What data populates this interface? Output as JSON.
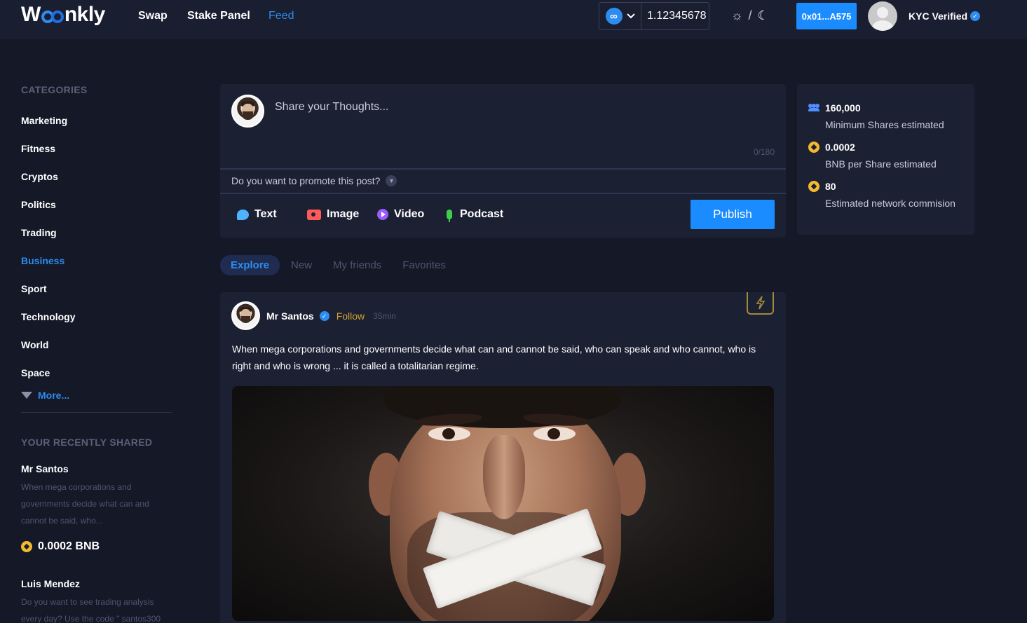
{
  "header": {
    "logo_text": "Woonkly",
    "nav": [
      {
        "label": "Swap"
      },
      {
        "label": "Stake Panel"
      },
      {
        "label": "Feed"
      }
    ],
    "token_value": "1.12345678",
    "theme_separator": "/",
    "wallet_label": "0x01...A575",
    "kyc_label": "KYC Verified"
  },
  "sidebar": {
    "categories_heading": "CATEGORIES",
    "categories": [
      {
        "label": "Marketing"
      },
      {
        "label": "Fitness"
      },
      {
        "label": "Cryptos"
      },
      {
        "label": "Politics"
      },
      {
        "label": "Trading"
      },
      {
        "label": "Business"
      },
      {
        "label": "Sport"
      },
      {
        "label": "Technology"
      },
      {
        "label": "World"
      },
      {
        "label": "Space"
      }
    ],
    "more_label": "More...",
    "recent_heading": "YOUR RECENTLY SHARED",
    "recent": [
      {
        "name": "Mr Santos",
        "text": "When mega corporations and governments decide what can and cannot be said, who...",
        "price": "0.0002 BNB"
      },
      {
        "name": "Luis Mendez",
        "text": "Do you want to see trading analysis every day? Use the code \" santos300"
      }
    ]
  },
  "composer": {
    "placeholder": "Share your Thoughts...",
    "char_count": "0/180",
    "promote_label": "Do you want to promote this post?",
    "types": [
      {
        "label": "Text"
      },
      {
        "label": "Image"
      },
      {
        "label": "Video"
      },
      {
        "label": "Podcast"
      }
    ],
    "publish_label": "Publish"
  },
  "feed_tabs": [
    {
      "label": "Explore"
    },
    {
      "label": "New"
    },
    {
      "label": "My friends"
    },
    {
      "label": "Favorites"
    }
  ],
  "post": {
    "author": "Mr Santos",
    "follow_label": "Follow",
    "time": "35min",
    "text": "When mega corporations and governments decide what can and cannot be said, who can speak and who cannot, who is right and who is wrong ... it is called a totalitarian regime."
  },
  "stats": [
    {
      "value": "160,000",
      "label": "Minimum Shares estimated",
      "icon": "users-icon"
    },
    {
      "value": "0.0002",
      "label": "BNB per Share estimated",
      "icon": "bnb-icon"
    },
    {
      "value": "80",
      "label": "Estimated network commision",
      "icon": "bnb-icon"
    }
  ],
  "colors": {
    "background": "#141827",
    "panel": "#1c2033",
    "accent_blue": "#1a8cff",
    "follow_gold": "#d4a32e",
    "bnb_yellow": "#f3ba2f"
  }
}
